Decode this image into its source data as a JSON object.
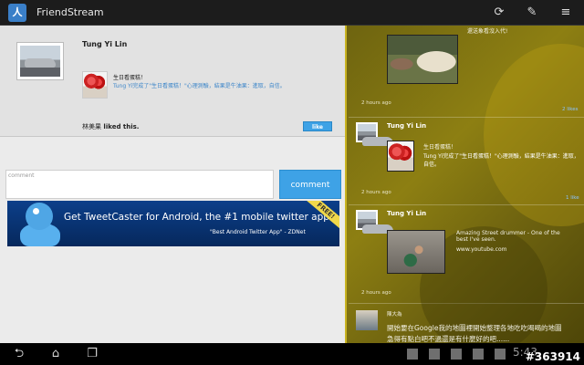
{
  "app": {
    "title": "FriendStream",
    "icon": "friendstream-logo"
  },
  "toolbar": {
    "refresh_icon": "refresh-icon",
    "compose_icon": "compose-icon",
    "menu_icon": "menu-icon"
  },
  "detail": {
    "author": "Tung Yi Lin",
    "post_title": "生日看蛋糕！",
    "post_subtitle": "Tung Yi完成了\"生日看蛋糕！\"心理測驗，結果是牛油果：進取，自信。",
    "liked_by": "林美果",
    "liked_text": " liked this.",
    "like_label": "like"
  },
  "comment": {
    "placeholder": "comment",
    "button_label": "comment"
  },
  "ad": {
    "headline": "Get TweetCaster for Android, the #1 mobile twitter app",
    "quote": "\"Best Android Twitter App\" - ZDNet",
    "ribbon": "FREE!"
  },
  "stream": [
    {
      "caption": "還送象看沒入代!",
      "time": "2 hours ago",
      "likes": "2 likes"
    },
    {
      "author": "Tung Yi Lin",
      "title": "生日看蛋糕！",
      "subtitle": "Tung Yi完成了\"生日看蛋糕！\"心理測驗，結果是牛油果：進取，自信。",
      "time": "2 hours ago",
      "likes": "1 like"
    },
    {
      "author": "Tung Yi Lin",
      "caption": "Amazing Street drummer - One of the best I've seen.",
      "link": "www.youtube.com",
      "time": "2 hours ago"
    },
    {
      "author": "陳大為",
      "text_line1": "開始要在Google我的地圖裡開始整理各地吃吃喝喝的地圖",
      "text_line2": "急得有點白吧不過還是有什麼好的吧......"
    }
  ],
  "nav": {
    "back_icon": "back-icon",
    "home_icon": "home-icon",
    "recents_icon": "recent-apps-icon",
    "clock": "5:43"
  },
  "watermark": "#363914"
}
